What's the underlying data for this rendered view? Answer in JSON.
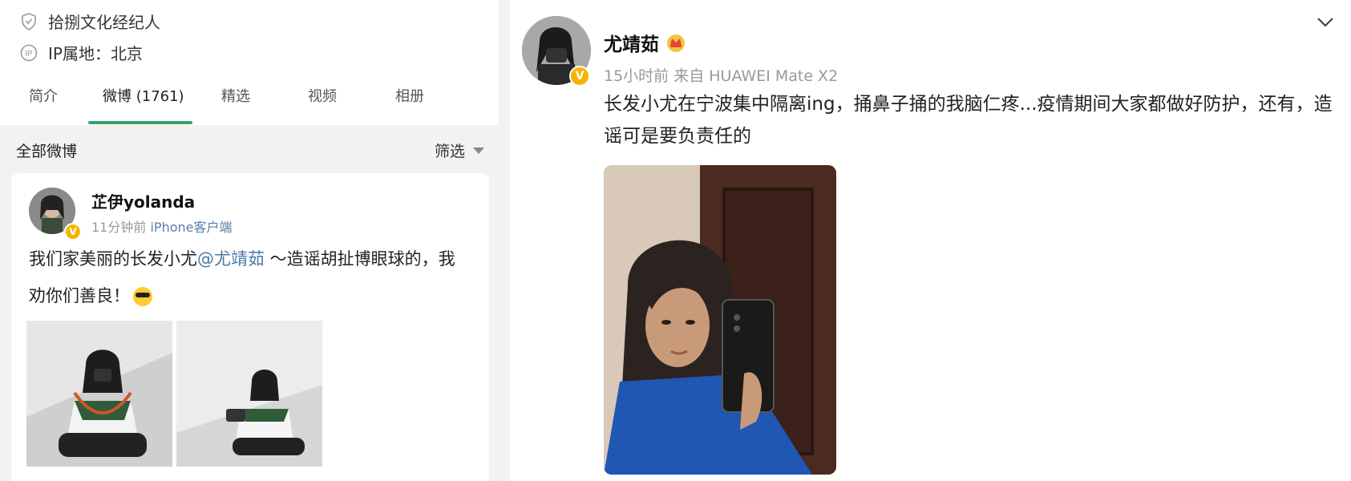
{
  "left": {
    "agency": "拾捌文化经纪人",
    "ip_location": "IP属地：北京",
    "tabs": [
      {
        "label": "简介"
      },
      {
        "label": "微博 (1761)"
      },
      {
        "label": "精选"
      },
      {
        "label": "视频"
      },
      {
        "label": "相册"
      }
    ],
    "feed_title": "全部微博",
    "filter_label": "筛选",
    "post": {
      "author": "芷伊yolanda",
      "time": "11分钟前",
      "source": "iPhone客户端",
      "text_before": "我们家美丽的长发小尤",
      "mention": "@尤靖茹",
      "text_after": " ～造谣胡扯博眼球的，我劝你们善良！",
      "emoji": "sunglasses-emoji"
    }
  },
  "right": {
    "author": "尤靖茹",
    "meta": "15小时前  来自 HUAWEI Mate X2",
    "text": "长发小尤在宁波集中隔离ing，捅鼻子捅的我脑仁疼...疫情期间大家都做好防护，还有，造谣可是要负责任的"
  },
  "colors": {
    "accent_green": "#37a26a",
    "link_blue": "#4d77a6",
    "verified_gold": "#f4b400"
  }
}
